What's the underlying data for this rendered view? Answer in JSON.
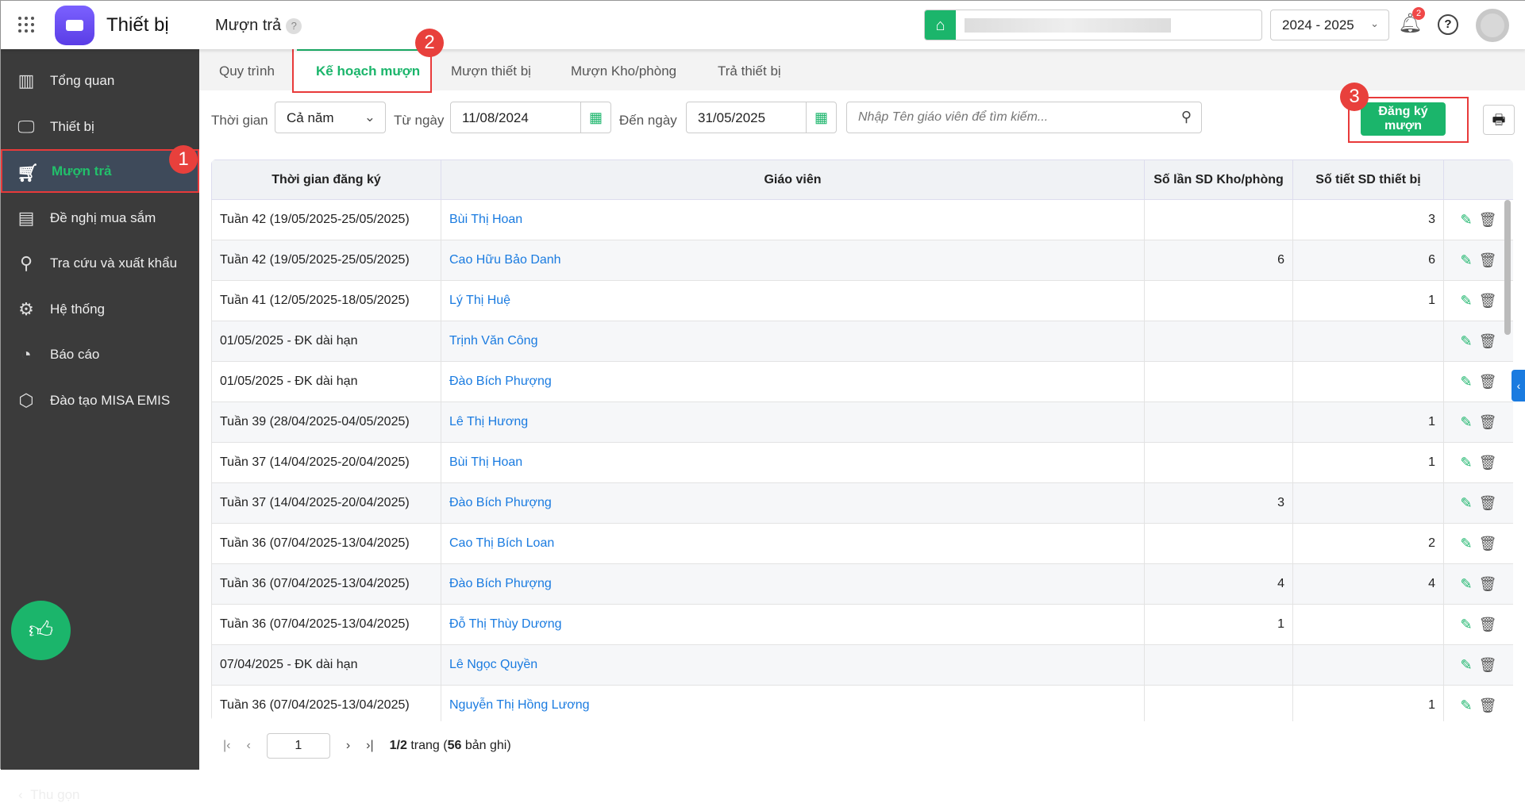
{
  "header": {
    "app_title": "Thiết bị",
    "page_title": "Mượn trả",
    "help": "?",
    "school_year": "2024 - 2025",
    "notification_count": "2"
  },
  "sidebar": {
    "items": [
      {
        "label": "Tổng quan",
        "icon": "chart-icon"
      },
      {
        "label": "Thiết bị",
        "icon": "monitor-icon"
      },
      {
        "label": "Mượn trả",
        "icon": "cart-icon"
      },
      {
        "label": "Đề nghị mua sắm",
        "icon": "projector-icon"
      },
      {
        "label": "Tra cứu và xuất khẩu",
        "icon": "search-icon"
      },
      {
        "label": "Hệ thống",
        "icon": "gear-icon"
      },
      {
        "label": "Báo cáo",
        "icon": "pie-icon"
      },
      {
        "label": "Đào tạo MISA EMIS",
        "icon": "box-icon"
      }
    ],
    "collapse": "Thu gọn"
  },
  "markers": [
    "1",
    "2",
    "3"
  ],
  "tabs": [
    "Quy trình",
    "Kế hoạch mượn",
    "Mượn thiết bị",
    "Mượn Kho/phòng",
    "Trả thiết bị"
  ],
  "filters": {
    "time_label": "Thời gian",
    "time_value": "Cả năm",
    "from_label": "Từ ngày",
    "from_value": "11/08/2024",
    "to_label": "Đến ngày",
    "to_value": "31/05/2025",
    "search_placeholder": "Nhập Tên giáo viên để tìm kiếm..."
  },
  "register_button": "Đăng ký mượn",
  "table": {
    "headers": [
      "Thời gian đăng ký",
      "Giáo viên",
      "Số lần SD Kho/phòng",
      "Số tiết SD thiết bị"
    ],
    "rows": [
      [
        "Tuần 42 (19/05/2025-25/05/2025)",
        "Bùi Thị Hoan",
        "",
        "3"
      ],
      [
        "Tuần 42 (19/05/2025-25/05/2025)",
        "Cao Hữu Bảo Danh",
        "6",
        "6"
      ],
      [
        "Tuần 41 (12/05/2025-18/05/2025)",
        "Lý Thị Huệ",
        "",
        "1"
      ],
      [
        "01/05/2025 - ĐK dài hạn",
        "Trịnh Văn Công",
        "",
        ""
      ],
      [
        "01/05/2025 - ĐK dài hạn",
        "Đào Bích Phượng",
        "",
        ""
      ],
      [
        "Tuần 39 (28/04/2025-04/05/2025)",
        "Lê Thị Hương",
        "",
        "1"
      ],
      [
        "Tuần 37 (14/04/2025-20/04/2025)",
        "Bùi Thị Hoan",
        "",
        "1"
      ],
      [
        "Tuần 37 (14/04/2025-20/04/2025)",
        "Đào Bích Phượng",
        "3",
        ""
      ],
      [
        "Tuần 36 (07/04/2025-13/04/2025)",
        "Cao Thị Bích Loan",
        "",
        "2"
      ],
      [
        "Tuần 36 (07/04/2025-13/04/2025)",
        "Đào Bích Phượng",
        "4",
        "4"
      ],
      [
        "Tuần 36 (07/04/2025-13/04/2025)",
        "Đỗ Thị Thùy Dương",
        "1",
        ""
      ],
      [
        "07/04/2025 - ĐK dài hạn",
        "Lê Ngọc Quyền",
        "",
        ""
      ],
      [
        "Tuần 36 (07/04/2025-13/04/2025)",
        "Nguyễn Thị Hồng Lương",
        "",
        "1"
      ]
    ]
  },
  "pagination": {
    "page": "1",
    "page_info": "1/2",
    "page_word": "trang",
    "total_open": "(",
    "total": "56",
    "total_word": "bản ghi)"
  }
}
